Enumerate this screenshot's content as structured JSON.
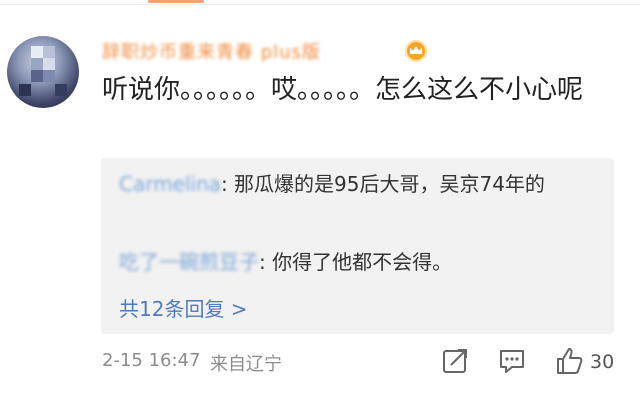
{
  "comment": {
    "username": "辞职炒币重来青春 plus版",
    "text": "听说你。。。。。。哎。。。。。怎么这么不小心呢"
  },
  "replies": [
    {
      "name": "Carmelina",
      "text": ": 那瓜爆的是95后大哥，吴京74年的"
    },
    {
      "name": "吃了一碗煎豆子",
      "text": ": 你得了他都不会得。"
    }
  ],
  "more_replies": "共12条回复 >",
  "footer": {
    "time": "2-15 16:47",
    "location": "来自辽宁",
    "like_count": "30"
  },
  "icons": [
    "share-icon",
    "comment-icon",
    "like-icon",
    "vip-icon"
  ],
  "colors": {
    "username": "#f08b3c",
    "reply_name": "#7aa4d8",
    "link": "#4f7bbd",
    "reply_bg": "#f2f2f2"
  }
}
